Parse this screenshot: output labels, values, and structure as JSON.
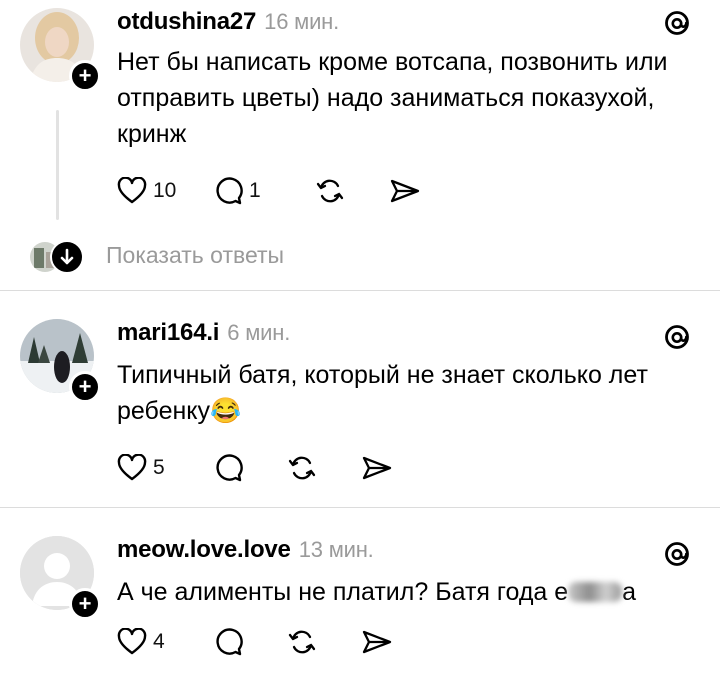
{
  "posts": [
    {
      "username": "otdushina27",
      "time": "16 мин.",
      "text": "Нет бы написать кроме вотсапа, позвонить или отправить цветы) надо заниматься показухой, кринж",
      "likes": "10",
      "replies": "1",
      "has_replies_link": true
    },
    {
      "username": "mari164.i",
      "time": "6 мин.",
      "text": "Типичный батя, который не знает сколько лет ребенку",
      "emoji": "😂",
      "likes": "5",
      "replies": ""
    },
    {
      "username": "meow.love.love",
      "time": "13 мин.",
      "text_visible": "А че алименты не платил? Батя года е",
      "text_tail": "а",
      "likes": "4",
      "replies": ""
    }
  ],
  "show_replies_label": "Показать ответы",
  "icons": {
    "like": "heart-icon",
    "reply": "comment-icon",
    "repost": "repost-icon",
    "share": "send-icon",
    "brand": "threads-icon",
    "follow": "plus-icon"
  }
}
